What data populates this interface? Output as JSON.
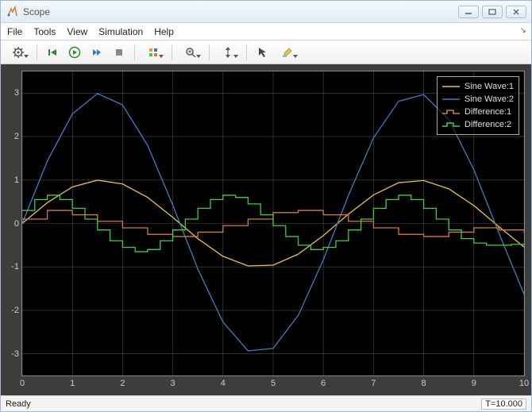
{
  "window": {
    "title": "Scope"
  },
  "menubar": {
    "items": [
      "File",
      "Tools",
      "View",
      "Simulation",
      "Help"
    ]
  },
  "toolbar": {
    "buttons": [
      {
        "name": "configure",
        "tip": "Configuration Properties"
      },
      {
        "name": "step-back",
        "tip": "Step Back"
      },
      {
        "name": "run",
        "tip": "Run"
      },
      {
        "name": "step-forward",
        "tip": "Step Forward"
      },
      {
        "name": "stop",
        "tip": "Stop"
      },
      {
        "name": "trigger",
        "tip": "Triggers"
      },
      {
        "name": "zoom",
        "tip": "Zoom"
      },
      {
        "name": "scale-y",
        "tip": "Scale Y-Axis Limits"
      },
      {
        "name": "cursors",
        "tip": "Cursor Measurements"
      },
      {
        "name": "highlight",
        "tip": "Highlight"
      }
    ]
  },
  "statusbar": {
    "left": "Ready",
    "right": "T=10.000"
  },
  "legend": {
    "items": [
      {
        "label": "Sine Wave:1",
        "color": "#e6c24a",
        "style": "line"
      },
      {
        "label": "Sine Wave:2",
        "color": "#3f7fbf",
        "style": "line"
      },
      {
        "label": "Difference:1",
        "color": "#d87a3a",
        "style": "stair"
      },
      {
        "label": "Difference:2",
        "color": "#3ecf3e",
        "style": "stair"
      }
    ]
  },
  "chart_data": {
    "type": "line",
    "xlabel": "",
    "ylabel": "",
    "xlim": [
      0,
      10
    ],
    "ylim": [
      -3.5,
      3.5
    ],
    "xticks": [
      0,
      1,
      2,
      3,
      4,
      5,
      6,
      7,
      8,
      9,
      10
    ],
    "yticks": [
      -3,
      -2,
      -1,
      0,
      1,
      2,
      3
    ],
    "grid": true,
    "legend_position": "top-right",
    "series": [
      {
        "name": "Sine Wave:1",
        "color": "#e6c24a",
        "style": "line",
        "equation": "sin(x)",
        "x": [
          0,
          0.5,
          1,
          1.5,
          2,
          2.5,
          3,
          3.5,
          4,
          4.5,
          5,
          5.5,
          6,
          6.5,
          7,
          7.5,
          8,
          8.5,
          9,
          9.5,
          10
        ],
        "y": [
          0,
          0.479,
          0.841,
          0.997,
          0.909,
          0.599,
          0.141,
          -0.351,
          -0.757,
          -0.978,
          -0.959,
          -0.706,
          -0.279,
          0.215,
          0.657,
          0.938,
          0.989,
          0.798,
          0.412,
          -0.075,
          -0.544
        ]
      },
      {
        "name": "Sine Wave:2",
        "color": "#3f7fbf",
        "style": "line",
        "equation": "3*sin(x)",
        "x": [
          0,
          0.5,
          1,
          1.5,
          2,
          2.5,
          3,
          3.5,
          4,
          4.5,
          5,
          5.5,
          6,
          6.5,
          7,
          7.5,
          8,
          8.5,
          9,
          9.5,
          10
        ],
        "y": [
          0,
          1.438,
          2.524,
          2.992,
          2.728,
          1.796,
          0.423,
          -1.052,
          -2.27,
          -2.933,
          -2.877,
          -2.117,
          -0.838,
          0.646,
          1.971,
          2.814,
          2.968,
          2.395,
          1.236,
          -0.225,
          -1.632
        ]
      },
      {
        "name": "Difference:1",
        "color": "#d87a3a",
        "style": "stair",
        "x": [
          0,
          0.5,
          1,
          1.5,
          2,
          2.5,
          3,
          3.5,
          4,
          4.5,
          5,
          5.5,
          6,
          6.5,
          7,
          7.5,
          8,
          8.5,
          9,
          9.5,
          10
        ],
        "y": [
          0.1,
          0.3,
          0.2,
          0.05,
          -0.1,
          -0.25,
          -0.3,
          -0.2,
          -0.05,
          0.1,
          0.25,
          0.3,
          0.2,
          0.05,
          -0.1,
          -0.25,
          -0.3,
          -0.2,
          -0.1,
          -0.15,
          -0.2
        ]
      },
      {
        "name": "Difference:2",
        "color": "#3ecf3e",
        "style": "stair",
        "x": [
          0,
          0.25,
          0.5,
          0.75,
          1,
          1.25,
          1.5,
          1.75,
          2,
          2.25,
          2.5,
          2.75,
          3,
          3.25,
          3.5,
          3.75,
          4,
          4.25,
          4.5,
          4.75,
          5,
          5.25,
          5.5,
          5.75,
          6,
          6.25,
          6.5,
          6.75,
          7,
          7.25,
          7.5,
          7.75,
          8,
          8.25,
          8.5,
          8.75,
          9,
          9.25,
          9.5,
          9.75,
          10
        ],
        "y": [
          0.3,
          0.55,
          0.65,
          0.55,
          0.35,
          0.1,
          -0.15,
          -0.4,
          -0.55,
          -0.65,
          -0.6,
          -0.4,
          -0.15,
          0.1,
          0.35,
          0.55,
          0.65,
          0.6,
          0.45,
          0.2,
          -0.05,
          -0.3,
          -0.5,
          -0.6,
          -0.55,
          -0.4,
          -0.15,
          0.1,
          0.35,
          0.55,
          0.65,
          0.55,
          0.35,
          0.1,
          -0.15,
          -0.35,
          -0.45,
          -0.5,
          -0.5,
          -0.48,
          -0.5
        ]
      }
    ]
  }
}
